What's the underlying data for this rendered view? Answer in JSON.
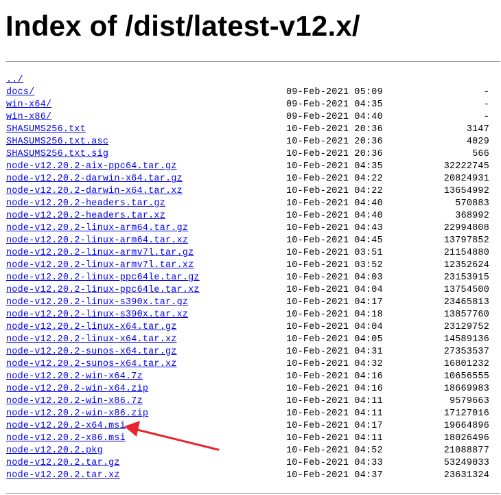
{
  "page": {
    "heading": "Index of /dist/latest-v12.x/"
  },
  "colors": {
    "link": "#0000ee",
    "annotation_arrow": "#e8242d",
    "rule": "#9a9a9a"
  },
  "annotation": {
    "icon": "red-arrow-icon",
    "points_to": "node-v12.20.2-x64.msi"
  },
  "listing": [
    {
      "name": "../",
      "date": "",
      "size": ""
    },
    {
      "name": "docs/",
      "date": "09-Feb-2021 05:09",
      "size": "-"
    },
    {
      "name": "win-x64/",
      "date": "09-Feb-2021 04:35",
      "size": "-"
    },
    {
      "name": "win-x86/",
      "date": "09-Feb-2021 04:40",
      "size": "-"
    },
    {
      "name": "SHASUMS256.txt",
      "date": "10-Feb-2021 20:36",
      "size": "3147"
    },
    {
      "name": "SHASUMS256.txt.asc",
      "date": "10-Feb-2021 20:36",
      "size": "4029"
    },
    {
      "name": "SHASUMS256.txt.sig",
      "date": "10-Feb-2021 20:36",
      "size": "566"
    },
    {
      "name": "node-v12.20.2-aix-ppc64.tar.gz",
      "date": "10-Feb-2021 04:35",
      "size": "32222745"
    },
    {
      "name": "node-v12.20.2-darwin-x64.tar.gz",
      "date": "10-Feb-2021 04:22",
      "size": "20824931"
    },
    {
      "name": "node-v12.20.2-darwin-x64.tar.xz",
      "date": "10-Feb-2021 04:22",
      "size": "13654992"
    },
    {
      "name": "node-v12.20.2-headers.tar.gz",
      "date": "10-Feb-2021 04:40",
      "size": "570883"
    },
    {
      "name": "node-v12.20.2-headers.tar.xz",
      "date": "10-Feb-2021 04:40",
      "size": "368992"
    },
    {
      "name": "node-v12.20.2-linux-arm64.tar.gz",
      "date": "10-Feb-2021 04:43",
      "size": "22994808"
    },
    {
      "name": "node-v12.20.2-linux-arm64.tar.xz",
      "date": "10-Feb-2021 04:45",
      "size": "13797852"
    },
    {
      "name": "node-v12.20.2-linux-armv7l.tar.gz",
      "date": "10-Feb-2021 03:51",
      "size": "21154880"
    },
    {
      "name": "node-v12.20.2-linux-armv7l.tar.xz",
      "date": "10-Feb-2021 03:52",
      "size": "12352624"
    },
    {
      "name": "node-v12.20.2-linux-ppc64le.tar.gz",
      "date": "10-Feb-2021 04:03",
      "size": "23153915"
    },
    {
      "name": "node-v12.20.2-linux-ppc64le.tar.xz",
      "date": "10-Feb-2021 04:04",
      "size": "13754500"
    },
    {
      "name": "node-v12.20.2-linux-s390x.tar.gz",
      "date": "10-Feb-2021 04:17",
      "size": "23465813"
    },
    {
      "name": "node-v12.20.2-linux-s390x.tar.xz",
      "date": "10-Feb-2021 04:18",
      "size": "13857760"
    },
    {
      "name": "node-v12.20.2-linux-x64.tar.gz",
      "date": "10-Feb-2021 04:04",
      "size": "23129752"
    },
    {
      "name": "node-v12.20.2-linux-x64.tar.xz",
      "date": "10-Feb-2021 04:05",
      "size": "14589136"
    },
    {
      "name": "node-v12.20.2-sunos-x64.tar.gz",
      "date": "10-Feb-2021 04:31",
      "size": "27353537"
    },
    {
      "name": "node-v12.20.2-sunos-x64.tar.xz",
      "date": "10-Feb-2021 04:32",
      "size": "16801232"
    },
    {
      "name": "node-v12.20.2-win-x64.7z",
      "date": "10-Feb-2021 04:16",
      "size": "10656555"
    },
    {
      "name": "node-v12.20.2-win-x64.zip",
      "date": "10-Feb-2021 04:16",
      "size": "18669983"
    },
    {
      "name": "node-v12.20.2-win-x86.7z",
      "date": "10-Feb-2021 04:11",
      "size": "9579663"
    },
    {
      "name": "node-v12.20.2-win-x86.zip",
      "date": "10-Feb-2021 04:11",
      "size": "17127016"
    },
    {
      "name": "node-v12.20.2-x64.msi",
      "date": "10-Feb-2021 04:17",
      "size": "19664896"
    },
    {
      "name": "node-v12.20.2-x86.msi",
      "date": "10-Feb-2021 04:11",
      "size": "18026496"
    },
    {
      "name": "node-v12.20.2.pkg",
      "date": "10-Feb-2021 04:52",
      "size": "21088877"
    },
    {
      "name": "node-v12.20.2.tar.gz",
      "date": "10-Feb-2021 04:33",
      "size": "53249033"
    },
    {
      "name": "node-v12.20.2.tar.xz",
      "date": "10-Feb-2021 04:37",
      "size": "23631324"
    }
  ]
}
